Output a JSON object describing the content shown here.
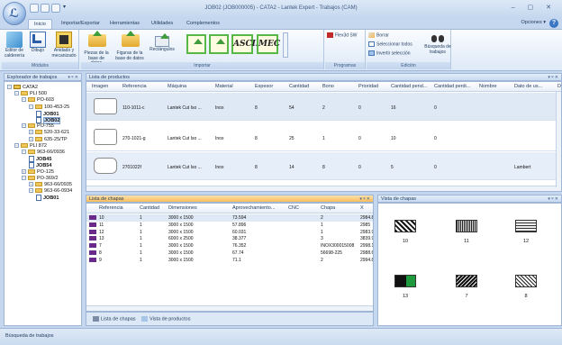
{
  "window": {
    "title": "JOB02 (JOB000005) - CATA2 - Lantek Expert - Trabajos (CAM)",
    "controls": "– ▢ ✕"
  },
  "tabs": [
    "Inicio",
    "Importar/Exportar",
    "Herramientas",
    "Utilidades",
    "Complementos"
  ],
  "options": {
    "label": "Opciones",
    "help": "?"
  },
  "ribbon": {
    "groups": [
      "Módulos",
      "Importar",
      "Programas",
      "Edición"
    ],
    "buttons": {
      "editor_caldereria": "Editor de calderería",
      "dibujo": "Dibujo",
      "anidado": "Anidado y mecanizado",
      "piezas_bd": "Piezas de la base de datos",
      "figuras_bd": "Figuras de la base de datos",
      "rectangulos": "Rectángulos",
      "ascii": "ASCII",
      "mec": "MEC",
      "flex3d": "Flex3d SW",
      "borrar": "Borrar",
      "seleccionar_todos": "Seleccionar todos",
      "invertir_seleccion": "Invertir selección",
      "busqueda_trabajos": "Búsqueda de trabajos"
    }
  },
  "explorer": {
    "title": "Explorador de trabajos",
    "ctrl": "▾ ᵠ ✕",
    "tree": [
      {
        "label": "CATA2",
        "level": 0,
        "kind": "root",
        "pm": "−"
      },
      {
        "label": "PLI 500",
        "level": 1,
        "kind": "folder",
        "pm": "−"
      },
      {
        "label": "PO-603",
        "level": 2,
        "kind": "folder",
        "pm": "−"
      },
      {
        "label": "100-453-25",
        "level": 3,
        "kind": "folder",
        "pm": "−"
      },
      {
        "label": "JOB01",
        "level": 4,
        "kind": "job"
      },
      {
        "label": "JOB02",
        "level": 4,
        "kind": "job-selected"
      },
      {
        "label": "PO-755",
        "level": 2,
        "kind": "folder",
        "pm": "−"
      },
      {
        "label": "520-33-621",
        "level": 3,
        "kind": "folder",
        "pm": "+"
      },
      {
        "label": "635-25/TP",
        "level": 3,
        "kind": "folder",
        "pm": "+"
      },
      {
        "label": "PLI 872",
        "level": 1,
        "kind": "folder",
        "pm": "−"
      },
      {
        "label": "963-66/0936",
        "level": 2,
        "kind": "folder",
        "pm": "−"
      },
      {
        "label": "JOB45",
        "level": 3,
        "kind": "job"
      },
      {
        "label": "JOB54",
        "level": 3,
        "kind": "job"
      },
      {
        "label": "PO-125",
        "level": 2,
        "kind": "folder",
        "pm": "+"
      },
      {
        "label": "PO-369/2",
        "level": 2,
        "kind": "folder",
        "pm": "−"
      },
      {
        "label": "963-66/0935",
        "level": 3,
        "kind": "folder",
        "pm": "+"
      },
      {
        "label": "963-66-0934",
        "level": 3,
        "kind": "folder",
        "pm": "−"
      },
      {
        "label": "JOB01",
        "level": 4,
        "kind": "job"
      }
    ]
  },
  "products": {
    "title": "Lista de productos",
    "ctrl": "▾ ᵠ ✕",
    "columns": [
      "Imagen",
      "Referencia",
      "Máquina",
      "Material",
      "Espesor",
      "Cantidad",
      "Bono",
      "Prioridad",
      "Cantidad pend...",
      "Cantidad perdi...",
      "Nombre",
      "Dato de us...",
      "D"
    ],
    "rows": [
      [
        "110-1011-c",
        "Lantek Cut Iso ...",
        "Inox",
        "8",
        "54",
        "2",
        "0",
        "16",
        "0",
        "",
        ""
      ],
      [
        "270-1021-g",
        "Lantek Cut Iso ...",
        "Inox",
        "8",
        "25",
        "1",
        "0",
        "10",
        "0",
        "",
        ""
      ],
      [
        "2701022f",
        "Lantek Cut Iso ...",
        "Inox",
        "8",
        "14",
        "8",
        "0",
        "5",
        "0",
        "",
        "Lambert"
      ]
    ]
  },
  "sheets": {
    "title": "Lista de chapas",
    "ctrl": "▾ ᵠ ✕",
    "columns": [
      "Referencia",
      "Cantidad",
      "Dimensiones",
      "Aprovechamiento...",
      "CNC",
      "Chapa",
      "X"
    ],
    "rows": [
      {
        "ref": "10",
        "qty": "1",
        "dim": "3000 x 1500",
        "aprov": "73.594",
        "cnc": "",
        "chapa": "2",
        "x": "2984.8",
        "color": "#6a2a8a"
      },
      {
        "ref": "11",
        "qty": "1",
        "dim": "3000 x 1500",
        "aprov": "57.896",
        "cnc": "",
        "chapa": "1",
        "x": "2985",
        "color": "#6a2a8a"
      },
      {
        "ref": "12",
        "qty": "1",
        "dim": "3000 x 1500",
        "aprov": "60.031",
        "cnc": "",
        "chapa": "1",
        "x": "2983.9",
        "color": "#6a2a8a"
      },
      {
        "ref": "13",
        "qty": "1",
        "dim": "6000 x 2500",
        "aprov": "38.377",
        "cnc": "",
        "chapa": "3",
        "x": "3839.985",
        "color": "#6a2a8a"
      },
      {
        "ref": "7",
        "qty": "1",
        "dim": "3000 x 1500",
        "aprov": "76.352",
        "cnc": "",
        "chapa": "INOX300015008",
        "x": "2998.114",
        "color": "#6a2a8a"
      },
      {
        "ref": "8",
        "qty": "1",
        "dim": "3000 x 1500",
        "aprov": "67.74",
        "cnc": "",
        "chapa": "56698-225",
        "x": "2988.6",
        "color": "#6a2a8a"
      },
      {
        "ref": "9",
        "qty": "1",
        "dim": "3000 x 1500",
        "aprov": "71.1",
        "cnc": "",
        "chapa": "2",
        "x": "2994.8",
        "color": "#6a2a8a"
      }
    ],
    "bottom_tabs": [
      "Lista de chapas",
      "Vista de productos"
    ]
  },
  "sheet_view": {
    "title": "Vista de chapas",
    "ctrl": "▾ ᵠ ✕",
    "items": [
      "10",
      "11",
      "12",
      "13",
      "7",
      "8"
    ]
  },
  "status": {
    "text": "Búsqueda de trabajos"
  }
}
